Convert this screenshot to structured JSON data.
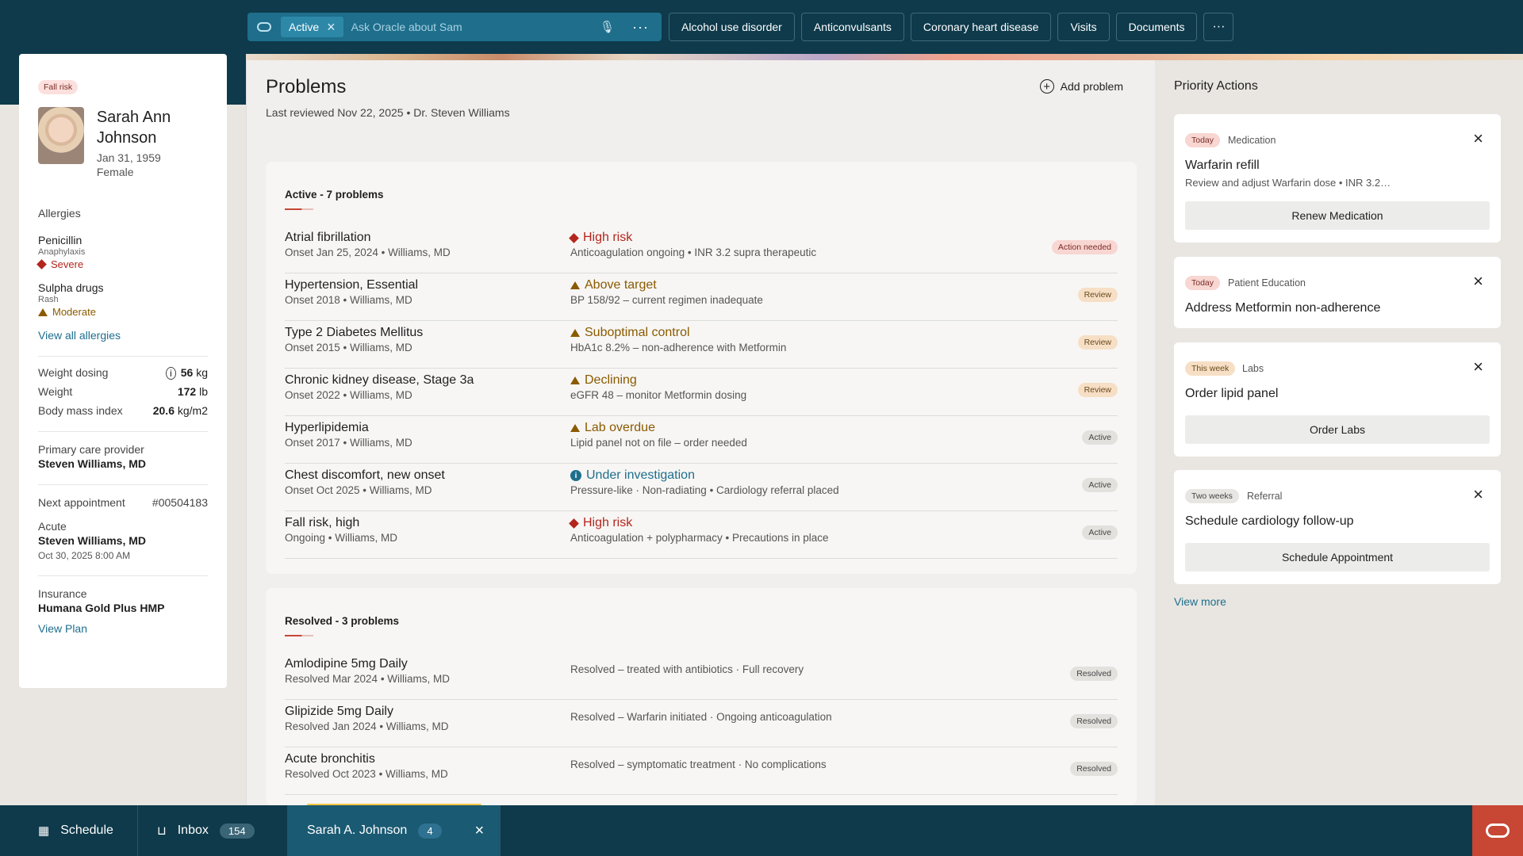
{
  "topbar": {
    "active_chip": "Active",
    "ask_placeholder": "Ask Oracle about Sam",
    "tabs": [
      "Alcohol use disorder",
      "Anticonvulsants",
      "Coronary heart disease",
      "Visits",
      "Documents"
    ],
    "more": "···"
  },
  "patient": {
    "badge": "Fall risk",
    "name": "Sarah Ann Johnson",
    "dob": "Jan 31, 1959",
    "sex": "Female",
    "allergies_title": "Allergies",
    "allergies": [
      {
        "name": "Penicillin",
        "reaction": "Anaphylaxis",
        "severity": "Severe"
      },
      {
        "name": "Sulpha drugs",
        "reaction": "Rash",
        "severity": "Moderate"
      }
    ],
    "view_all_allergies": "View all allergies",
    "weight_dosing_label": "Weight dosing",
    "weight_dosing_value": "56",
    "weight_dosing_unit": "kg",
    "weight_label": "Weight",
    "weight_value": "172",
    "weight_unit": "lb",
    "bmi_label": "Body mass index",
    "bmi_value": "20.6",
    "bmi_unit": "kg/m2",
    "pcp_label": "Primary care provider",
    "pcp_value": "Steven Williams, MD",
    "next_appt_label": "Next appointment",
    "next_appt_id": "#00504183",
    "appt_type": "Acute",
    "appt_provider": "Steven Williams, MD",
    "appt_time": "Oct 30, 2025 8:00 AM",
    "insurance_label": "Insurance",
    "insurance_value": "Humana Gold Plus HMP",
    "view_plan": "View Plan"
  },
  "problems": {
    "title": "Problems",
    "subtitle": "Last reviewed Nov 22, 2025 • Dr. Steven Williams",
    "add_label": "Add problem",
    "active_title": "Active - 7 problems",
    "active": [
      {
        "name": "Atrial fibrillation",
        "meta": "Onset Jan 25, 2024  •  Williams, MD",
        "status": "High risk",
        "detail": "Anticoagulation ongoing • INR 3.2 supra therapeutic",
        "tag": "Action needed"
      },
      {
        "name": "Hypertension, Essential",
        "meta": "Onset 2018 • Williams, MD",
        "status": "Above target",
        "detail": "BP 158/92 – current regimen inadequate",
        "tag": "Review"
      },
      {
        "name": "Type 2 Diabetes Mellitus",
        "meta": "Onset 2015 • Williams, MD",
        "status": "Suboptimal control",
        "detail": "HbA1c 8.2% – non-adherence with Metformin",
        "tag": "Review"
      },
      {
        "name": "Chronic kidney disease, Stage 3a",
        "meta": "Onset 2022 • Williams, MD",
        "status": "Declining",
        "detail": "eGFR 48 – monitor Metformin dosing",
        "tag": "Review"
      },
      {
        "name": "Hyperlipidemia",
        "meta": "Onset 2017 • Williams, MD",
        "status": "Lab overdue",
        "detail": "Lipid panel not on file – order needed",
        "tag": "Active"
      },
      {
        "name": "Chest discomfort, new onset",
        "meta": "Onset Oct 2025 • Williams, MD",
        "status": "Under investigation",
        "detail": "Pressure-like · Non-radiating • Cardiology referral placed",
        "tag": "Active"
      },
      {
        "name": "Fall risk, high",
        "meta": "Ongoing  •  Williams, MD",
        "status": "High risk",
        "detail": "Anticoagulation + polypharmacy • Precautions in place",
        "tag": "Active"
      }
    ],
    "resolved_title": "Resolved - 3 problems",
    "resolved": [
      {
        "name": "Amlodipine",
        "dose": "5mg Daily",
        "meta": "Resolved Mar 2024 • Williams, MD",
        "detail": "Resolved – treated with antibiotics · Full recovery",
        "tag": "Resolved"
      },
      {
        "name": "Glipizide",
        "dose": "5mg Daily",
        "meta": "Resolved Jan 2024 • Williams, MD",
        "detail": "Resolved – Warfarin initiated · Ongoing anticoagulation",
        "tag": "Resolved"
      },
      {
        "name": "Acute bronchitis",
        "dose": "",
        "meta": "Resolved Oct 2023 • Williams, MD",
        "detail": "Resolved – symptomatic treatment · No complications",
        "tag": "Resolved"
      }
    ]
  },
  "priority": {
    "title": "Priority Actions",
    "cards": [
      {
        "when": "Today",
        "category": "Medication",
        "title": "Warfarin refill",
        "desc": "Review and adjust Warfarin dose • INR 3.2…",
        "button": "Renew Medication"
      },
      {
        "when": "Today",
        "category": "Patient Education",
        "title": "Address Metformin non-adherence"
      },
      {
        "when": "This week",
        "category": "Labs",
        "title": "Order lipid panel",
        "button": "Order Labs"
      },
      {
        "when": "Two weeks",
        "category": "Referral",
        "title": "Schedule cardiology follow-up",
        "button": "Schedule Appointment"
      }
    ],
    "view_more": "View more"
  },
  "bottom": {
    "schedule": "Schedule",
    "inbox": "Inbox",
    "inbox_count": "154",
    "patient_tab": "Sarah A. Johnson",
    "patient_count": "4"
  },
  "colors": {
    "header": "#0e3a4b",
    "accent_teal": "#1e6e8c",
    "oracle_red": "#c74634",
    "high_risk": "#b3261e",
    "warning": "#8a5a00"
  }
}
